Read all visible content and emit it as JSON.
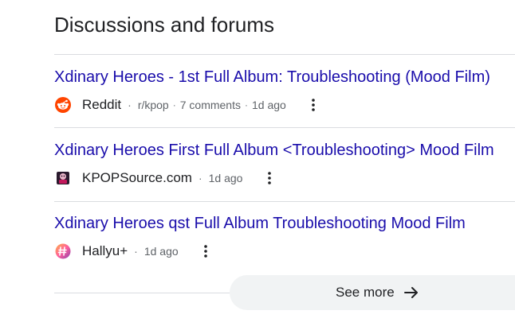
{
  "section": {
    "title": "Discussions and forums"
  },
  "results": [
    {
      "link_text": "Xdinary Heroes - 1st Full Album: Troubleshooting (Mood Film)",
      "site": "Reddit",
      "community": "r/kpop",
      "comments": "7 comments",
      "age": "1d ago",
      "icon": "reddit-icon"
    },
    {
      "link_text": "Xdinary Heroes First Full Album <Troubleshooting> Mood Film",
      "site": "KPOPSource.com",
      "age": "1d ago",
      "icon": "kpopsource-icon"
    },
    {
      "link_text": "Xdinary Heroes qst Full Album Troubleshooting Mood Film",
      "site": "Hallyu+",
      "age": "1d ago",
      "icon": "hallyu-icon"
    }
  ],
  "see_more": {
    "label": "See more",
    "icon": "arrow-right-icon"
  },
  "colors": {
    "link": "#1a0dab",
    "reddit": "#ff4500",
    "see_more_bg": "#f1f3f4"
  }
}
